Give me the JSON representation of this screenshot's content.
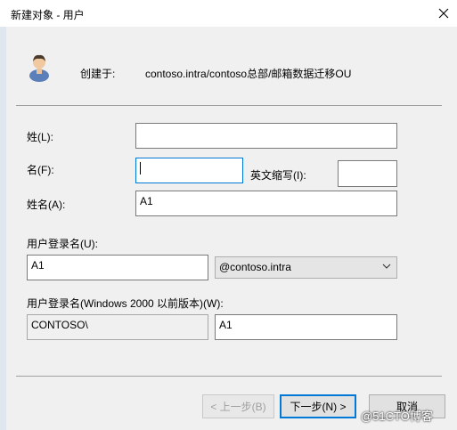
{
  "window": {
    "title": "新建对象 - 用户"
  },
  "header": {
    "created_in_label": "创建于:",
    "path": "contoso.intra/contoso总部/邮箱数据迁移OU"
  },
  "form": {
    "last_name_label": "姓(L):",
    "last_name_value": "",
    "first_name_label": "名(F):",
    "first_name_value": "",
    "initials_label": "英文缩写(I):",
    "initials_value": "",
    "full_name_label": "姓名(A):",
    "full_name_value": "A1",
    "logon_name_label": "用户登录名(U):",
    "logon_name_value": "A1",
    "domain_selected": "@contoso.intra",
    "pre2000_label": "用户登录名(Windows 2000 以前版本)(W):",
    "pre2000_domain": "CONTOSO\\",
    "pre2000_name": "A1"
  },
  "buttons": {
    "back": "< 上一步(B)",
    "next": "下一步(N) >",
    "cancel": "取消"
  },
  "watermark": "@51CTO博客",
  "icons": {
    "user": "user-icon",
    "close": "close-icon",
    "dropdown": "chevron-down-icon"
  }
}
